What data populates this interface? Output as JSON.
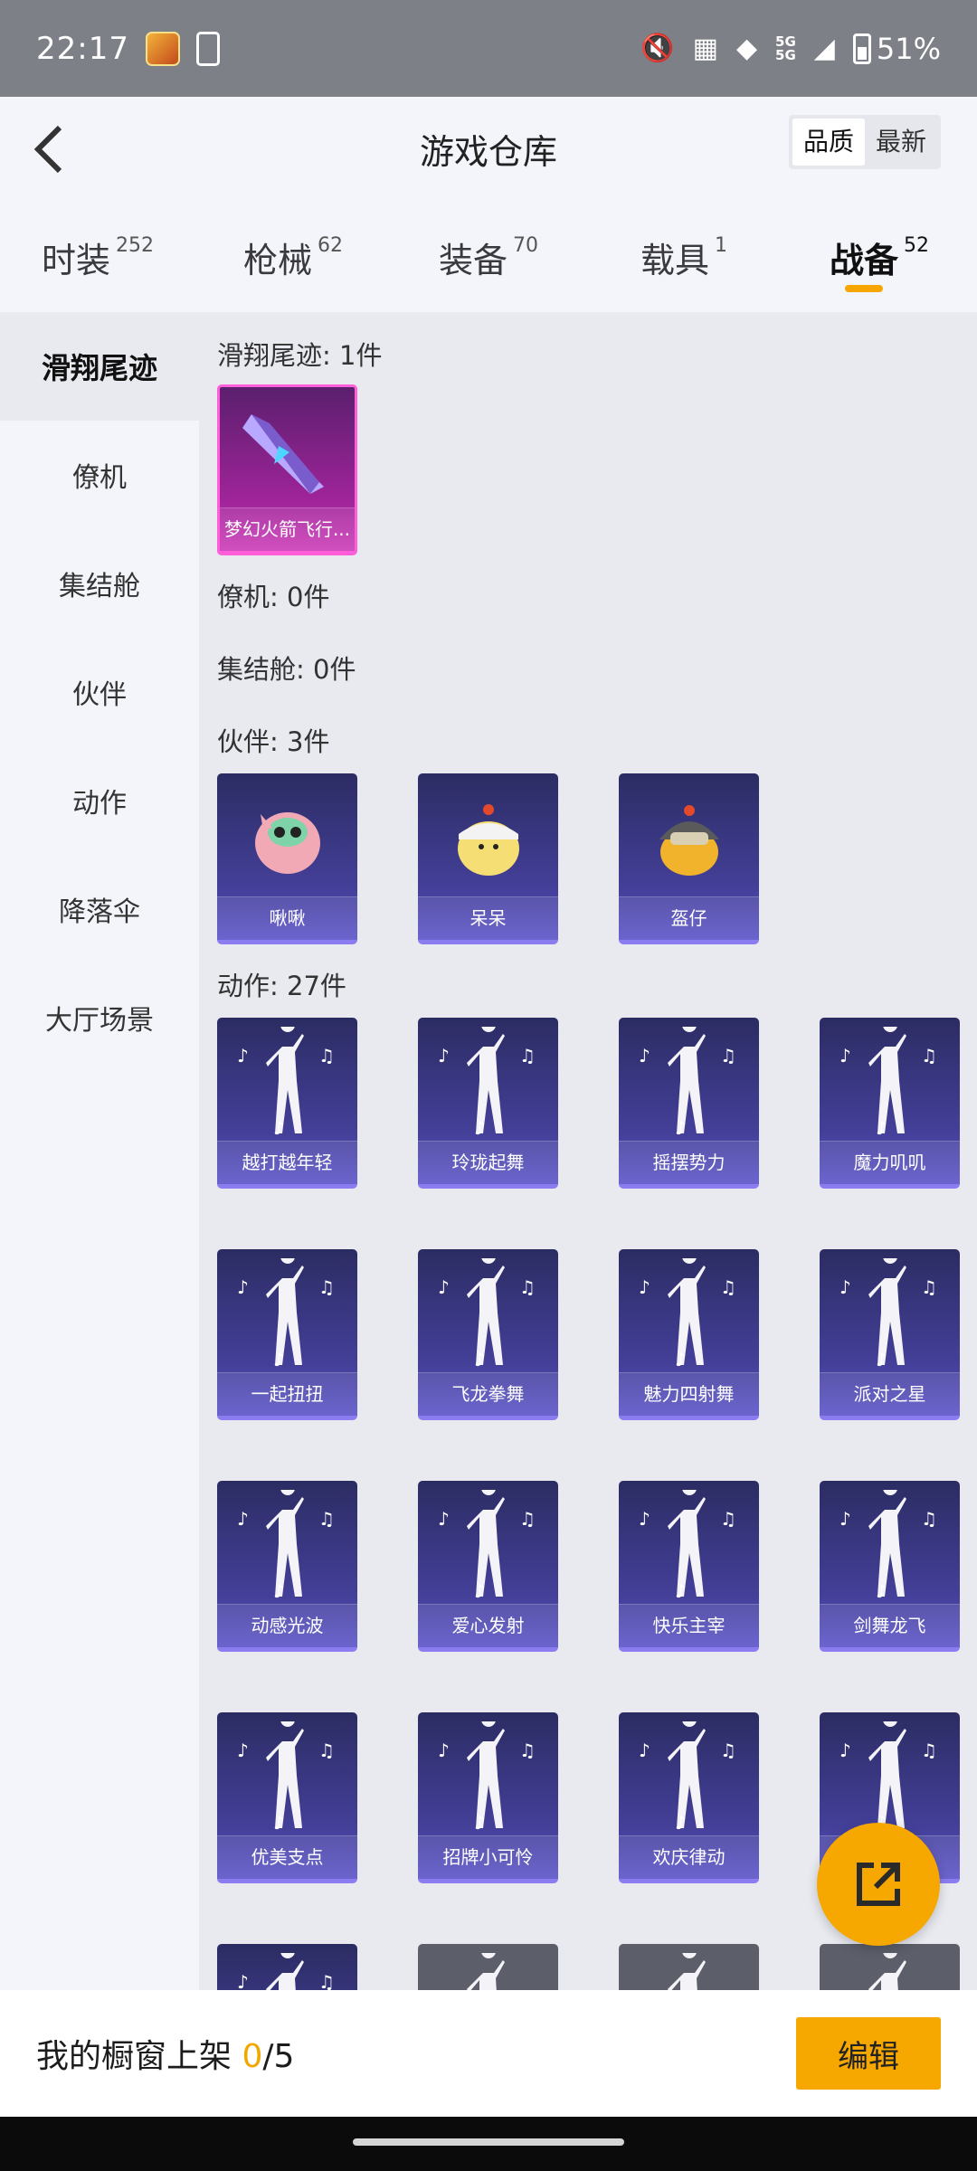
{
  "status_bar": {
    "time": "22:17",
    "battery": "51%",
    "network": "5G"
  },
  "header": {
    "title": "游戏仓库",
    "sort_options": [
      "品质",
      "最新"
    ]
  },
  "tabs": [
    {
      "label": "时装",
      "count": "252"
    },
    {
      "label": "枪械",
      "count": "62"
    },
    {
      "label": "装备",
      "count": "70"
    },
    {
      "label": "载具",
      "count": "1"
    },
    {
      "label": "战备",
      "count": "52"
    }
  ],
  "sidebar": [
    "滑翔尾迹",
    "僚机",
    "集结舱",
    "伙伴",
    "动作",
    "降落伞",
    "大厅场景"
  ],
  "sections": {
    "glide": "滑翔尾迹: 1件",
    "wingman": "僚机: 0件",
    "capsule": "集结舱: 0件",
    "partner": "伙伴: 3件",
    "emote": "动作: 27件"
  },
  "glide_items": [
    "梦幻火箭飞行..."
  ],
  "partner_items": [
    "啾啾",
    "呆呆",
    "盔仔"
  ],
  "emote_items": [
    "越打越年轻",
    "玲珑起舞",
    "摇摆势力",
    "魔力叽叽",
    "一起扭扭",
    "飞龙拳舞",
    "魅力四射舞",
    "派对之星",
    "动感光波",
    "爱心发射",
    "快乐主宰",
    "剑舞龙飞",
    "优美支点",
    "招牌小可怜",
    "欢庆律动",
    ""
  ],
  "bottom": {
    "shelf_label": "我的橱窗上架 ",
    "shelf_current": "0",
    "shelf_total": "/5",
    "edit_label": "编辑"
  },
  "colors": {
    "accent": "#f6a800",
    "card_purple": "#44409a",
    "card_pink": "#cc3bb7"
  }
}
